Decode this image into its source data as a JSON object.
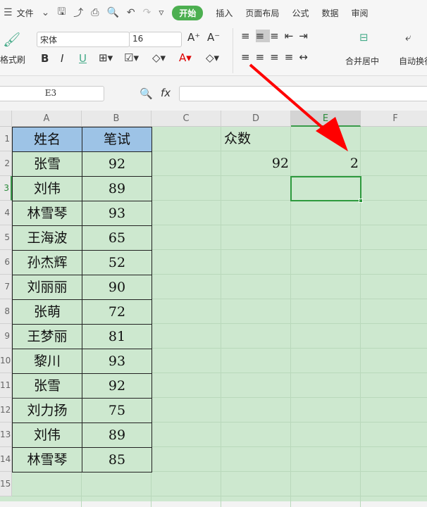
{
  "toolbar": {
    "menu_label": "文件",
    "tabs": [
      "开始",
      "插入",
      "页面布局",
      "公式",
      "数据",
      "审阅"
    ]
  },
  "ribbon": {
    "format_painter": "格式刷",
    "font_name": "宋体",
    "font_size": "16",
    "bold": "B",
    "italic": "I",
    "underline": "U",
    "merge_center": "合并居中",
    "wrap_text": "自动换行"
  },
  "formula_bar": {
    "cell_ref": "E3",
    "fx": "fx",
    "value": ""
  },
  "columns": [
    "A",
    "B",
    "C",
    "D",
    "E",
    "F"
  ],
  "rows": [
    "1",
    "2",
    "3",
    "4",
    "5",
    "6",
    "7",
    "8",
    "9",
    "10",
    "11",
    "12",
    "13",
    "14",
    "15"
  ],
  "table": {
    "headers": [
      "姓名",
      "笔试"
    ],
    "records": [
      [
        "张雪",
        "92"
      ],
      [
        "刘伟",
        "89"
      ],
      [
        "林雪琴",
        "93"
      ],
      [
        "王海波",
        "65"
      ],
      [
        "孙杰辉",
        "52"
      ],
      [
        "刘丽丽",
        "90"
      ],
      [
        "张萌",
        "72"
      ],
      [
        "王梦丽",
        "81"
      ],
      [
        "黎川",
        "93"
      ],
      [
        "张雪",
        "92"
      ],
      [
        "刘力扬",
        "75"
      ],
      [
        "刘伟",
        "89"
      ],
      [
        "林雪琴",
        "85"
      ]
    ]
  },
  "mode": {
    "label": "众数",
    "value": "92",
    "count": "2"
  },
  "colors": {
    "accent": "#4caf50",
    "header_fill": "#9dc3e6",
    "sheet_bg": "#cde8cf",
    "arrow": "#ff0000"
  }
}
